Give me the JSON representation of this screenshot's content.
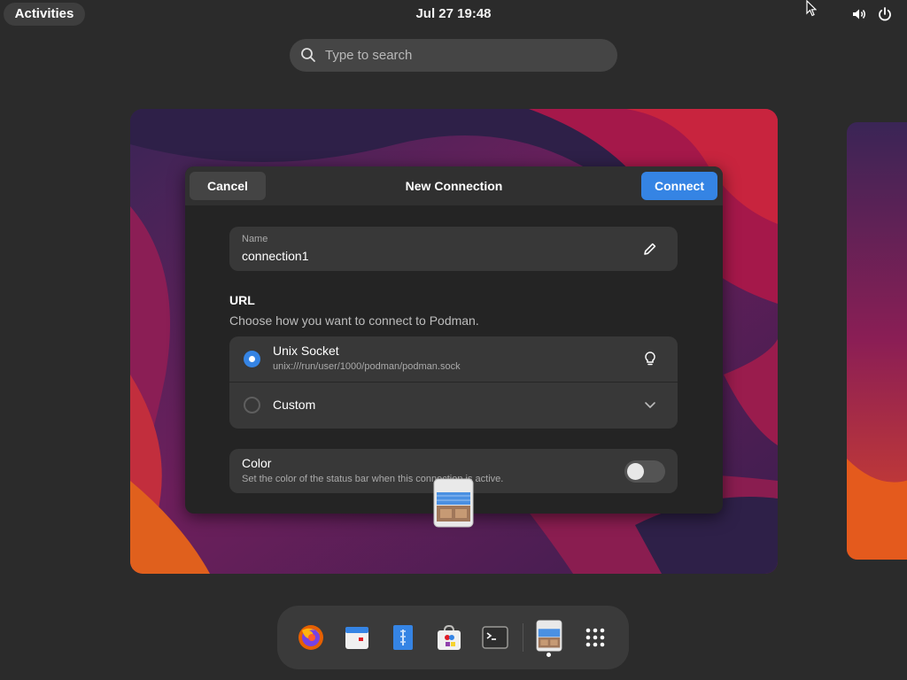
{
  "topbar": {
    "activities_label": "Activities",
    "clock": "Jul 27  19:48",
    "icons": [
      "volume-icon",
      "power-icon"
    ]
  },
  "search": {
    "placeholder": "Type to search"
  },
  "dialog": {
    "cancel_label": "Cancel",
    "title": "New Connection",
    "connect_label": "Connect",
    "name": {
      "label": "Name",
      "value": "connection1"
    },
    "url": {
      "title": "URL",
      "description": "Choose how you want to connect to Podman.",
      "options": [
        {
          "label": "Unix Socket",
          "subtitle": "unix:///run/user/1000/podman/podman.sock",
          "selected": true,
          "icon": "lightbulb-icon"
        },
        {
          "label": "Custom",
          "selected": false,
          "icon": "chevron-down-icon"
        }
      ]
    },
    "color": {
      "title": "Color",
      "subtitle": "Set the color of the status bar when this connection is active.",
      "enabled": false
    }
  },
  "dash": {
    "apps": [
      "firefox",
      "calendar",
      "text-editor",
      "software",
      "terminal",
      "pods"
    ],
    "grid_icon": "app-grid-icon"
  },
  "colors": {
    "accent": "#3584e4",
    "dialog_bg": "#242424",
    "card_bg": "#383838"
  }
}
